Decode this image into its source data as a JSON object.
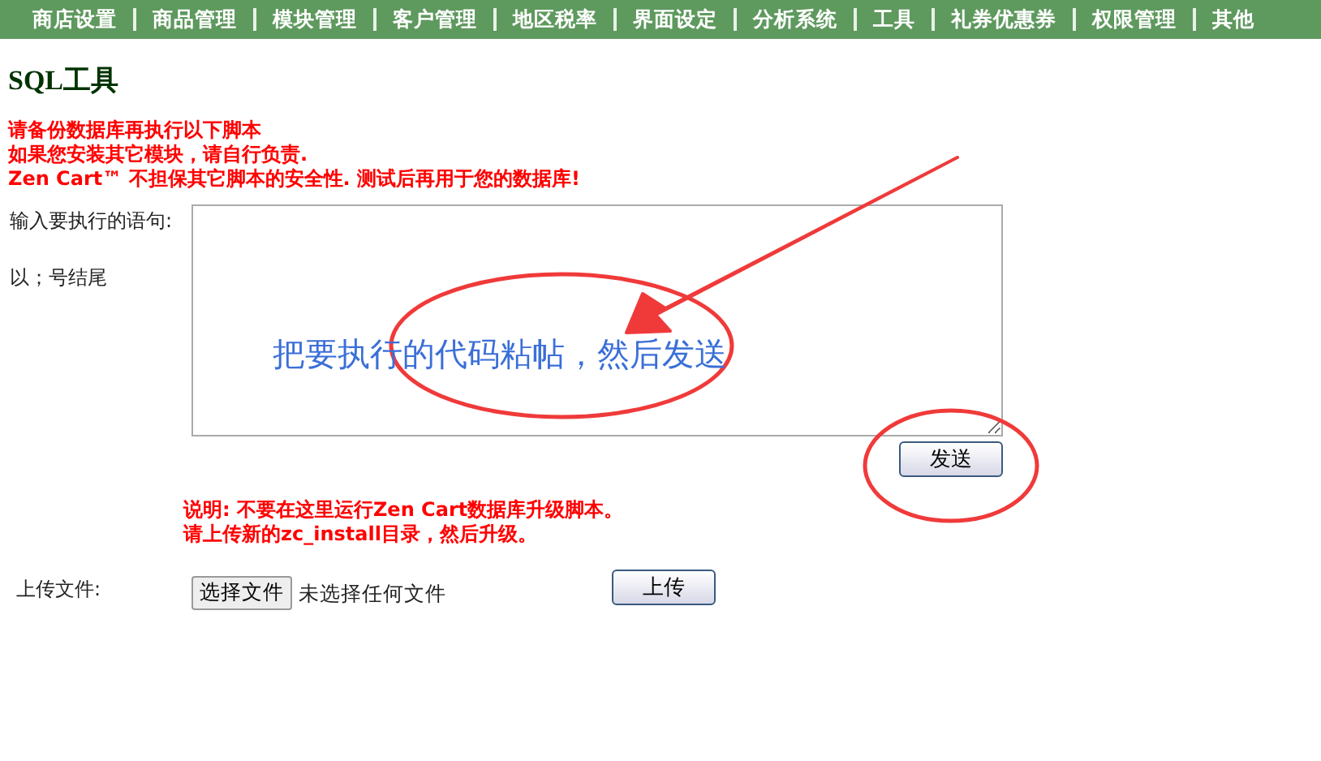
{
  "nav": {
    "items": [
      "商店设置",
      "商品管理",
      "模块管理",
      "客户管理",
      "地区税率",
      "界面设定",
      "分析系统",
      "工具",
      "礼券优惠券",
      "权限管理",
      "其他"
    ]
  },
  "page_title": "SQL工具",
  "warnings": [
    "请备份数据库再执行以下脚本",
    "如果您安装其它模块，请自行负责.",
    "Zen Cart™ 不担保其它脚本的安全性. 测试后再用于您的数据库!"
  ],
  "query_form": {
    "label": "输入要执行的语句:",
    "hint": "以；号结尾",
    "send_button": "发送"
  },
  "notes": [
    "说明: 不要在这里运行Zen Cart数据库升级脚本。",
    "请上传新的zc_install目录，然后升级。"
  ],
  "upload": {
    "label": "上传文件:",
    "choose_button": "选择文件",
    "file_status": "未选择任何文件",
    "upload_button": "上传"
  },
  "annotation": {
    "text": "把要执行的代码粘帖，然后发送"
  }
}
